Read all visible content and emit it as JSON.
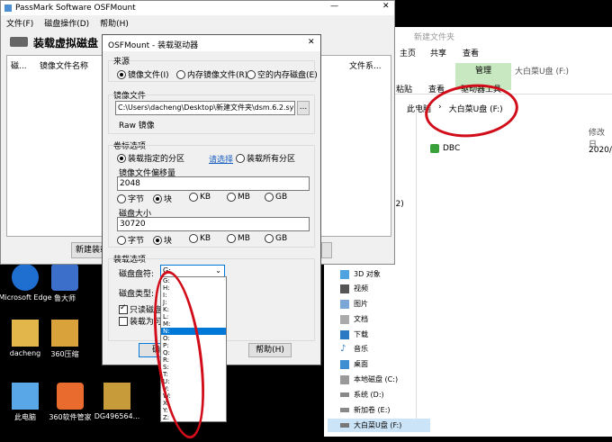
{
  "colors": {
    "desktop": "#000000",
    "titlebar": "#ffffff",
    "dialog_bg": "#f0f0f0",
    "selection": "#0078d7",
    "ribbon_manage": "#c7e8c0",
    "annotation": "#d10d1a"
  },
  "main_window": {
    "title": "PassMark Software OSFMount",
    "menu": [
      "文件(F)",
      "磁盘操作(D)",
      "帮助(H)"
    ],
    "heading": "装载虚拟磁盘",
    "columns": [
      "磁...",
      "镜像文件名称",
      "文件系..."
    ],
    "new_mount_button": "新建装载"
  },
  "dialog": {
    "title": "OSFMount - 装载驱动器",
    "source_group": "来源",
    "source_options": [
      "镜像文件(I)",
      "内存镜像文件(R)",
      "空的内存磁盘(E)"
    ],
    "image_file_label": "镜像文件",
    "image_file_value": "C:\\Users\\dacheng\\Desktop\\新建文件夹\\dsm.6.2.synobo",
    "browse_button": "...",
    "image_type": "Raw 镜像",
    "volume_group": "卷标选项",
    "volume_options": [
      "装载指定的分区",
      "装载所有分区"
    ],
    "select_link": "请选择",
    "offset_label": "镜像文件偏移量",
    "offset_value": "2048",
    "disk_size_label": "磁盘大小",
    "disk_size_value": "30720",
    "units": [
      "字节",
      "块",
      "KB",
      "MB",
      "GB"
    ],
    "mount_group": "装载选项",
    "drive_letter_label": "磁盘盘符:",
    "drive_letter_value": "G:",
    "disk_type_label": "磁盘类型:",
    "readonly_label": "只读磁盘",
    "removable_label": "装载为可移",
    "ok_button": "确定",
    "help_button": "帮助(H)",
    "drive_list": [
      "G:",
      "H:",
      "I:",
      "J:",
      "K:",
      "L:",
      "M:",
      "N:",
      "O:",
      "P:",
      "Q:",
      "R:",
      "S:",
      "T:",
      "U:",
      "V:",
      "W:",
      "X:",
      "Y:",
      "Z:"
    ],
    "drive_selected": "N:"
  },
  "explorer": {
    "title": "新建文件夹",
    "tabs": [
      "主页",
      "共享",
      "查看"
    ],
    "manage_tab": "管理",
    "drive_title": "大白菜U盘 (F:)",
    "ribbon_items": [
      "粘贴",
      "查看"
    ],
    "drive_tools_tab": "驱动器工具",
    "breadcrumb": [
      "此电脑",
      "大白菜U盘 (F:)"
    ],
    "column_modified": "修改日",
    "file_name": "DBC",
    "file_date": "2020/",
    "quick_item": "(2)",
    "nav_items": [
      "3D 对象",
      "视频",
      "图片",
      "文档",
      "下载",
      "音乐",
      "桌面",
      "本地磁盘 (C:)",
      "系统 (D:)",
      "新加卷 (E:)",
      "大白菜U盘 (F:)"
    ]
  },
  "desktop_icons": [
    {
      "label": "Microsoft Edge",
      "icon": "edge-icon"
    },
    {
      "label": "鲁大师",
      "icon": "ludashi-icon"
    },
    {
      "label": "dacheng",
      "icon": "user-folder-icon"
    },
    {
      "label": "360压缩",
      "icon": "archive-icon"
    },
    {
      "label": "此电脑",
      "icon": "computer-icon"
    },
    {
      "label": "360软件管家",
      "icon": "software-manager-icon"
    },
    {
      "label": "DG496564...",
      "icon": "diskgenius-icon"
    }
  ]
}
